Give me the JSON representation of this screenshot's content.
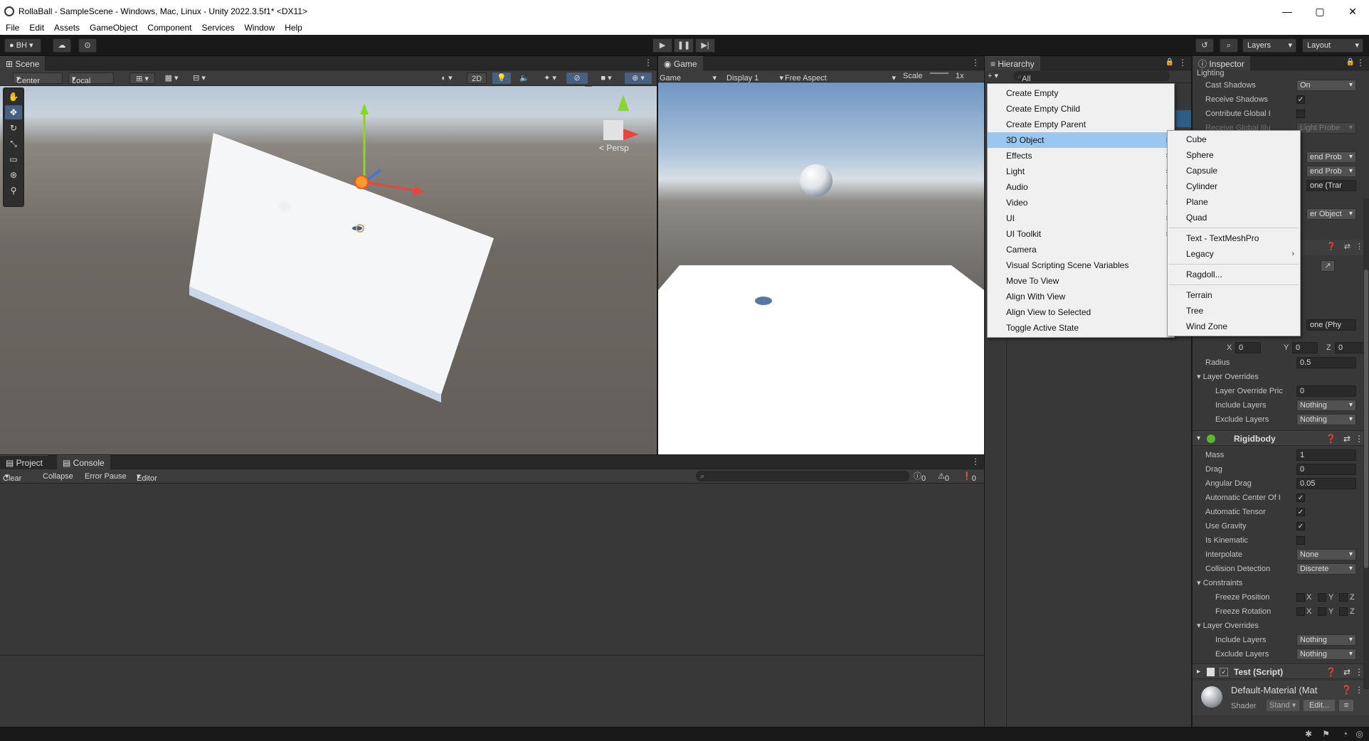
{
  "window": {
    "title": "RollaBall - SampleScene - Windows, Mac, Linux - Unity 2022.3.5f1* <DX11>",
    "minimize": "—",
    "maximize": "▢",
    "close": "✕"
  },
  "menubar": [
    "File",
    "Edit",
    "Assets",
    "GameObject",
    "Component",
    "Services",
    "Window",
    "Help"
  ],
  "toolbar": {
    "account": "BH",
    "layers": "Layers",
    "layout": "Layout"
  },
  "scene": {
    "tab": "Scene",
    "pivot": "Center",
    "space": "Local",
    "twoD": "2D",
    "persp": "Persp"
  },
  "game": {
    "tab": "Game",
    "mode": "Game",
    "display": "Display 1",
    "aspect": "Free Aspect",
    "scale_label": "Scale",
    "scale_value": "1x"
  },
  "hierarchy": {
    "tab": "Hierarchy",
    "search_placeholder": "All"
  },
  "inspector": {
    "tab": "Inspector",
    "lighting_header": "Lighting",
    "cast_shadows": {
      "label": "Cast Shadows",
      "value": "On"
    },
    "receive_shadows": {
      "label": "Receive Shadows"
    },
    "contribute_gi": {
      "label": "Contribute Global I"
    },
    "receive_gi": {
      "label": "Receive Global Illu",
      "value": "Light Probe"
    },
    "partial": {
      "blend1": "end Prob",
      "blend2": "end Prob",
      "tran": "one (Trar",
      "object": "er Object",
      "phy": "one (Phy"
    },
    "center": {
      "x": "0",
      "y": "0",
      "z": "0"
    },
    "radius": {
      "label": "Radius",
      "value": "0.5"
    },
    "layer_overrides": "Layer Overrides",
    "layer_override_priority": {
      "label": "Layer Override Pric",
      "value": "0"
    },
    "include_layers": {
      "label": "Include Layers",
      "value": "Nothing"
    },
    "exclude_layers": {
      "label": "Exclude Layers",
      "value": "Nothing"
    },
    "rigidbody": {
      "title": "Rigidbody",
      "mass": {
        "label": "Mass",
        "value": "1"
      },
      "drag": {
        "label": "Drag",
        "value": "0"
      },
      "angular_drag": {
        "label": "Angular Drag",
        "value": "0.05"
      },
      "auto_center": {
        "label": "Automatic Center Of I"
      },
      "auto_tensor": {
        "label": "Automatic Tensor"
      },
      "use_gravity": {
        "label": "Use Gravity"
      },
      "is_kinematic": {
        "label": "Is Kinematic"
      },
      "interpolate": {
        "label": "Interpolate",
        "value": "None"
      },
      "collision": {
        "label": "Collision Detection",
        "value": "Discrete"
      },
      "constraints": "Constraints",
      "freeze_position": "Freeze Position",
      "freeze_rotation": "Freeze Rotation",
      "layer_overrides": "Layer Overrides",
      "include_layers": {
        "label": "Include Layers",
        "value": "Nothing"
      },
      "exclude_layers": {
        "label": "Exclude Layers",
        "value": "Nothing"
      }
    },
    "test_script": "Test (Script)",
    "material": {
      "name": "Default-Material (Mat",
      "shader_label": "Shader",
      "shader_value": "Stand",
      "edit": "Edit..."
    }
  },
  "axes": {
    "x": "X",
    "y": "Y",
    "z": "Z"
  },
  "project": {
    "tab": "Project",
    "console_tab": "Console",
    "clear": "Clear",
    "collapse": "Collapse",
    "error_pause": "Error Pause",
    "editor": "Editor",
    "info_count": "0",
    "warn_count": "0",
    "error_count": "0"
  },
  "create_menu": [
    "Create Empty",
    "Create Empty Child",
    "Create Empty Parent",
    "3D Object",
    "Effects",
    "Light",
    "Audio",
    "Video",
    "UI",
    "UI Toolkit",
    "Camera",
    "Visual Scripting Scene Variables",
    "Move To View",
    "Align With View",
    "Align View to Selected",
    "Toggle Active State"
  ],
  "submenu_3d": [
    "Cube",
    "Sphere",
    "Capsule",
    "Cylinder",
    "Plane",
    "Quad",
    "Text - TextMeshPro",
    "Legacy",
    "Ragdoll...",
    "Terrain",
    "Tree",
    "Wind Zone"
  ]
}
